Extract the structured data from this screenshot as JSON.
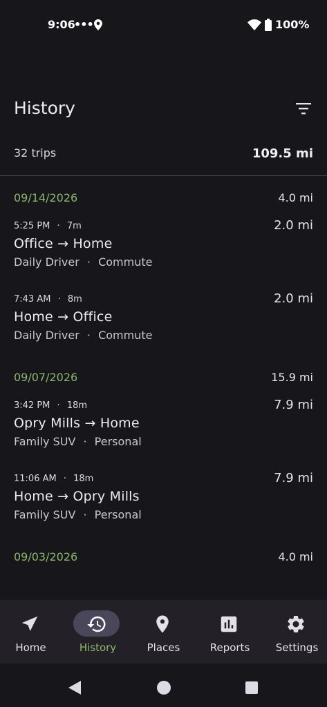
{
  "status_bar": {
    "time": "9:06",
    "dots": "•••",
    "battery": "100%"
  },
  "header": {
    "title": "History"
  },
  "summary": {
    "count": "32 trips",
    "total": "109.5 mi"
  },
  "groups": [
    {
      "date": "09/14/2026",
      "total": "4.0 mi",
      "trips": [
        {
          "time": "5:25 PM",
          "duration": "7m",
          "route": "Office → Home",
          "vehicle": "Daily Driver",
          "category": "Commute",
          "distance": "2.0 mi"
        },
        {
          "time": "7:43 AM",
          "duration": "8m",
          "route": "Home → Office",
          "vehicle": "Daily Driver",
          "category": "Commute",
          "distance": "2.0 mi"
        }
      ]
    },
    {
      "date": "09/07/2026",
      "total": "15.9 mi",
      "trips": [
        {
          "time": "3:42 PM",
          "duration": "18m",
          "route": "Opry Mills → Home",
          "vehicle": "Family SUV",
          "category": "Personal",
          "distance": "7.9 mi"
        },
        {
          "time": "11:06 AM",
          "duration": "18m",
          "route": "Home → Opry Mills",
          "vehicle": "Family SUV",
          "category": "Personal",
          "distance": "7.9 mi"
        }
      ]
    },
    {
      "date": "09/03/2026",
      "total": "4.0 mi",
      "trips": []
    }
  ],
  "separator": "·",
  "nav": {
    "items": [
      {
        "label": "Home",
        "icon": "navigation-arrow-icon"
      },
      {
        "label": "History",
        "icon": "history-icon",
        "active": true
      },
      {
        "label": "Places",
        "icon": "location-pin-icon"
      },
      {
        "label": "Reports",
        "icon": "bar-chart-icon"
      },
      {
        "label": "Settings",
        "icon": "gear-icon"
      }
    ]
  },
  "colors": {
    "accent": "#8bb76f",
    "background": "#17161b",
    "nav_bg": "#232127",
    "active_pill": "#4a475a"
  }
}
